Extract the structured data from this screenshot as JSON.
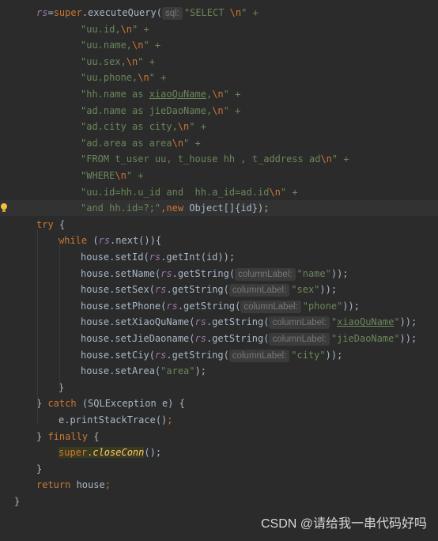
{
  "editor": {
    "lines": [
      {
        "indent": 46,
        "tokens": [
          {
            "t": "rs",
            "c": "var"
          },
          {
            "t": "=",
            "c": "plain"
          },
          {
            "t": "super",
            "c": "kw"
          },
          {
            "t": ".executeQuery(",
            "c": "plain"
          },
          {
            "t": "sql:",
            "c": "hint"
          },
          {
            "t": "\"SELECT ",
            "c": "str"
          },
          {
            "t": "\\n",
            "c": "esc"
          },
          {
            "t": "\" +",
            "c": "str"
          }
        ]
      },
      {
        "indent": 102,
        "tokens": [
          {
            "t": "\"uu.id,",
            "c": "str"
          },
          {
            "t": "\\n",
            "c": "esc"
          },
          {
            "t": "\" +",
            "c": "str"
          }
        ]
      },
      {
        "indent": 102,
        "tokens": [
          {
            "t": "\"uu.name,",
            "c": "str"
          },
          {
            "t": "\\n",
            "c": "esc"
          },
          {
            "t": "\" +",
            "c": "str"
          }
        ]
      },
      {
        "indent": 102,
        "tokens": [
          {
            "t": "\"uu.sex,",
            "c": "str"
          },
          {
            "t": "\\n",
            "c": "esc"
          },
          {
            "t": "\" +",
            "c": "str"
          }
        ]
      },
      {
        "indent": 102,
        "tokens": [
          {
            "t": "\"uu.phone,",
            "c": "str"
          },
          {
            "t": "\\n",
            "c": "esc"
          },
          {
            "t": "\" +",
            "c": "str"
          }
        ]
      },
      {
        "indent": 102,
        "tokens": [
          {
            "t": "\"hh.name as ",
            "c": "str"
          },
          {
            "t": "xiaoQuName",
            "c": "str-u"
          },
          {
            "t": ",",
            "c": "str"
          },
          {
            "t": "\\n",
            "c": "esc"
          },
          {
            "t": "\" +",
            "c": "str"
          }
        ]
      },
      {
        "indent": 102,
        "tokens": [
          {
            "t": "\"ad.name as jieDaoName,",
            "c": "str"
          },
          {
            "t": "\\n",
            "c": "esc"
          },
          {
            "t": "\" +",
            "c": "str"
          }
        ]
      },
      {
        "indent": 102,
        "tokens": [
          {
            "t": "\"ad.city as city,",
            "c": "str"
          },
          {
            "t": "\\n",
            "c": "esc"
          },
          {
            "t": "\" +",
            "c": "str"
          }
        ]
      },
      {
        "indent": 102,
        "tokens": [
          {
            "t": "\"ad.area as area",
            "c": "str"
          },
          {
            "t": "\\n",
            "c": "esc"
          },
          {
            "t": "\" +",
            "c": "str"
          }
        ]
      },
      {
        "indent": 102,
        "tokens": [
          {
            "t": "\"FROM t_user uu, t_house hh , t_address ad",
            "c": "str"
          },
          {
            "t": "\\n",
            "c": "esc"
          },
          {
            "t": "\" +",
            "c": "str"
          }
        ]
      },
      {
        "indent": 102,
        "tokens": [
          {
            "t": "\"WHERE",
            "c": "str"
          },
          {
            "t": "\\n",
            "c": "esc"
          },
          {
            "t": "\" +",
            "c": "str"
          }
        ]
      },
      {
        "indent": 102,
        "tokens": [
          {
            "t": "\"uu.id=hh.u_id and  hh.a_id=ad.id",
            "c": "str"
          },
          {
            "t": "\\n",
            "c": "esc"
          },
          {
            "t": "\" +",
            "c": "str"
          }
        ]
      },
      {
        "indent": 102,
        "hl": true,
        "bulb": true,
        "tokens": [
          {
            "t": "\"and hh.id=?;\"",
            "c": "str"
          },
          {
            "t": ",",
            "c": "kw"
          },
          {
            "t": "new ",
            "c": "kw"
          },
          {
            "t": "Object[]{id});",
            "c": "plain"
          }
        ]
      },
      {
        "indent": 46,
        "tokens": [
          {
            "t": "try ",
            "c": "kw"
          },
          {
            "t": "{",
            "c": "plain"
          }
        ]
      },
      {
        "indent": 74,
        "tokens": [
          {
            "t": "while ",
            "c": "kw"
          },
          {
            "t": "(",
            "c": "plain"
          },
          {
            "t": "rs",
            "c": "var"
          },
          {
            "t": ".next()){",
            "c": "plain"
          }
        ]
      },
      {
        "indent": 102,
        "tokens": [
          {
            "t": "house.setId(",
            "c": "plain"
          },
          {
            "t": "rs",
            "c": "var"
          },
          {
            "t": ".getInt(id));",
            "c": "plain"
          }
        ]
      },
      {
        "indent": 102,
        "tokens": [
          {
            "t": "house.setName(",
            "c": "plain"
          },
          {
            "t": "rs",
            "c": "var"
          },
          {
            "t": ".getString(",
            "c": "plain"
          },
          {
            "t": "columnLabel:",
            "c": "hint"
          },
          {
            "t": "\"name\"",
            "c": "str"
          },
          {
            "t": "));",
            "c": "plain"
          }
        ]
      },
      {
        "indent": 102,
        "tokens": [
          {
            "t": "house.setSex(",
            "c": "plain"
          },
          {
            "t": "rs",
            "c": "var"
          },
          {
            "t": ".getString(",
            "c": "plain"
          },
          {
            "t": "columnLabel:",
            "c": "hint"
          },
          {
            "t": "\"sex\"",
            "c": "str"
          },
          {
            "t": "));",
            "c": "plain"
          }
        ]
      },
      {
        "indent": 102,
        "tokens": [
          {
            "t": "house.setPhone(",
            "c": "plain"
          },
          {
            "t": "rs",
            "c": "var"
          },
          {
            "t": ".getString(",
            "c": "plain"
          },
          {
            "t": "columnLabel:",
            "c": "hint"
          },
          {
            "t": "\"phone\"",
            "c": "str"
          },
          {
            "t": "));",
            "c": "plain"
          }
        ]
      },
      {
        "indent": 102,
        "tokens": [
          {
            "t": "house.setXiaoQuName(",
            "c": "plain"
          },
          {
            "t": "rs",
            "c": "var"
          },
          {
            "t": ".getString(",
            "c": "plain"
          },
          {
            "t": "columnLabel:",
            "c": "hint"
          },
          {
            "t": "\"",
            "c": "str"
          },
          {
            "t": "xiaoQuName",
            "c": "str-u"
          },
          {
            "t": "\"",
            "c": "str"
          },
          {
            "t": "));",
            "c": "plain"
          }
        ]
      },
      {
        "indent": 102,
        "tokens": [
          {
            "t": "house.setJieDaoname(",
            "c": "plain"
          },
          {
            "t": "rs",
            "c": "var"
          },
          {
            "t": ".getString(",
            "c": "plain"
          },
          {
            "t": "columnLabel:",
            "c": "hint"
          },
          {
            "t": "\"jieDaoName\"",
            "c": "str"
          },
          {
            "t": "));",
            "c": "plain"
          }
        ]
      },
      {
        "indent": 102,
        "tokens": [
          {
            "t": "house.setCiy(",
            "c": "plain"
          },
          {
            "t": "rs",
            "c": "var"
          },
          {
            "t": ".getString(",
            "c": "plain"
          },
          {
            "t": "columnLabel:",
            "c": "hint"
          },
          {
            "t": "\"city\"",
            "c": "str"
          },
          {
            "t": "));",
            "c": "plain"
          }
        ]
      },
      {
        "indent": 102,
        "tokens": [
          {
            "t": "house.setArea(",
            "c": "plain"
          },
          {
            "t": "\"area\"",
            "c": "str"
          },
          {
            "t": ");",
            "c": "plain"
          }
        ]
      },
      {
        "indent": 74,
        "tokens": [
          {
            "t": "}",
            "c": "plain"
          }
        ]
      },
      {
        "indent": 46,
        "tokens": [
          {
            "t": "} ",
            "c": "plain"
          },
          {
            "t": "catch ",
            "c": "kw"
          },
          {
            "t": "(SQLException e) {",
            "c": "plain"
          }
        ]
      },
      {
        "indent": 74,
        "tokens": [
          {
            "t": "e.printStackTrace()",
            "c": "plain"
          },
          {
            "t": ";",
            "c": "kw"
          }
        ]
      },
      {
        "indent": 46,
        "tokens": [
          {
            "t": "} ",
            "c": "plain"
          },
          {
            "t": "finally ",
            "c": "kw"
          },
          {
            "t": "{",
            "c": "plain"
          }
        ]
      },
      {
        "indent": 74,
        "tokens": [
          {
            "t": "super",
            "c": "kw-box"
          },
          {
            "t": ".",
            "c": "plain-box"
          },
          {
            "t": "closeConn",
            "c": "ifn-box"
          },
          {
            "t": "();",
            "c": "plain"
          }
        ]
      },
      {
        "indent": 46,
        "tokens": [
          {
            "t": "}",
            "c": "plain"
          }
        ]
      },
      {
        "indent": 46,
        "tokens": [
          {
            "t": "return ",
            "c": "kw"
          },
          {
            "t": "house",
            "c": "plain"
          },
          {
            "t": ";",
            "c": "kw"
          }
        ]
      },
      {
        "indent": 18,
        "tokens": [
          {
            "t": "}",
            "c": "plain"
          }
        ]
      }
    ]
  },
  "watermark": "CSDN @请给我一串代码好吗"
}
